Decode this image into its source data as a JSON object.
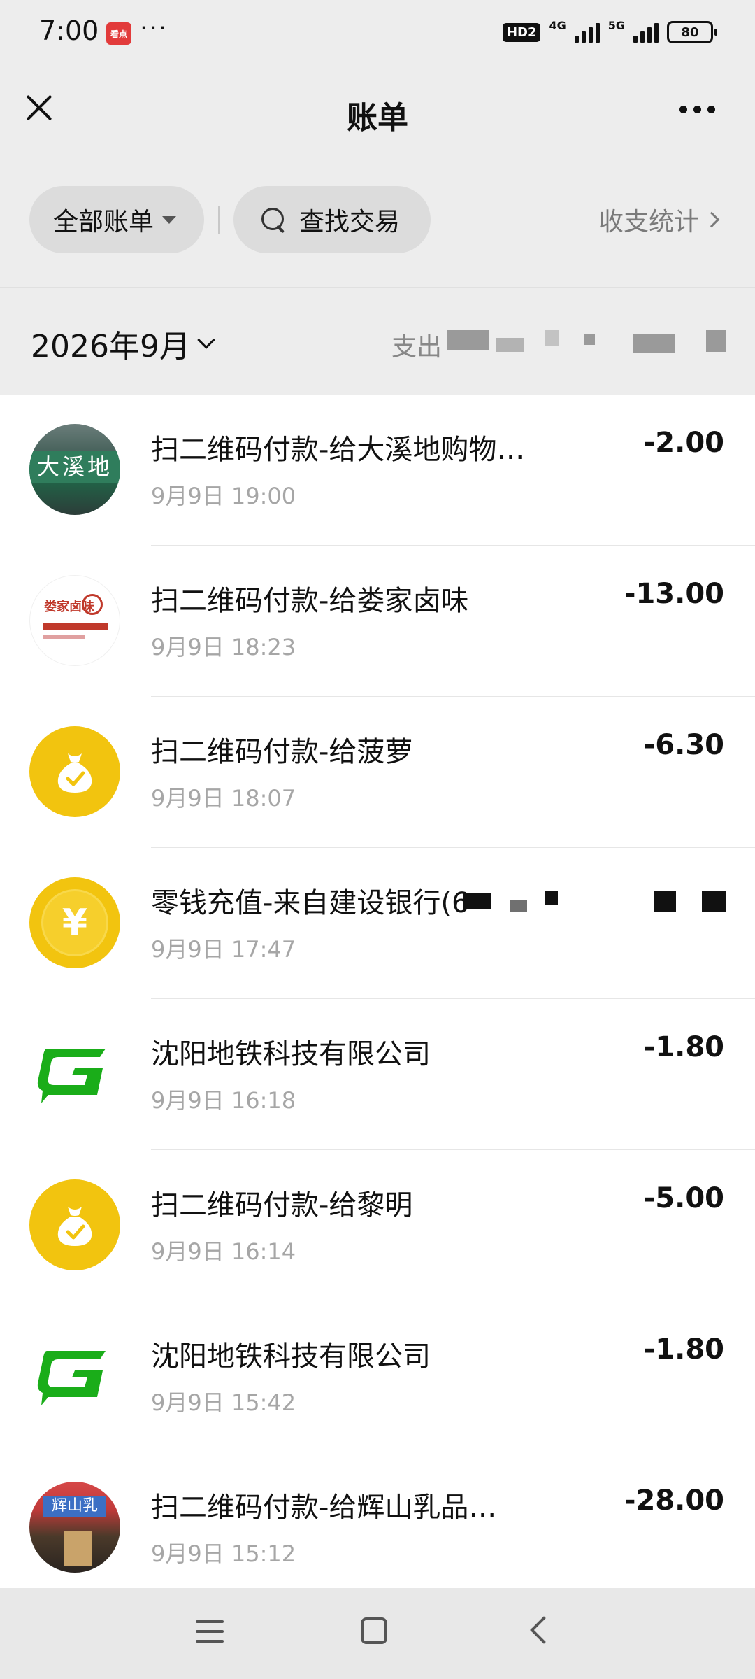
{
  "status_bar": {
    "time": "7:00",
    "app_badge": "看点",
    "more": "···",
    "hd": "HD2",
    "net1": "4G",
    "net2": "5G",
    "battery": "80"
  },
  "header": {
    "title": "账单"
  },
  "filters": {
    "all_bills": "全部账单",
    "search": "查找交易",
    "stats": "收支统计"
  },
  "month": {
    "label": "2026年9月",
    "summary_prefix": "支出"
  },
  "transactions": [
    {
      "title": "扫二维码付款-给大溪地购物…",
      "time": "9月9日 19:00",
      "amount": "-2.00",
      "avatar": "store-photo",
      "avatar_text": "大溪地"
    },
    {
      "title": "扫二维码付款-给娄家卤味",
      "time": "9月9日 18:23",
      "amount": "-13.00",
      "avatar": "store-logo",
      "avatar_text": "娄家卤味"
    },
    {
      "title": "扫二维码付款-给菠萝",
      "time": "9月9日 18:07",
      "amount": "-6.30",
      "avatar": "moneybag-icon"
    },
    {
      "title": "零钱充值-来自建设银行(6",
      "time": "9月9日 17:47",
      "amount": "",
      "avatar": "yuan-coin-icon",
      "avatar_text": "¥"
    },
    {
      "title": "沈阳地铁科技有限公司",
      "time": "9月9日 16:18",
      "amount": "-1.80",
      "avatar": "metro-logo-icon"
    },
    {
      "title": "扫二维码付款-给黎明",
      "time": "9月9日 16:14",
      "amount": "-5.00",
      "avatar": "moneybag-icon"
    },
    {
      "title": "沈阳地铁科技有限公司",
      "time": "9月9日 15:42",
      "amount": "-1.80",
      "avatar": "metro-logo-icon"
    },
    {
      "title": "扫二维码付款-给辉山乳品…",
      "time": "9月9日 15:12",
      "amount": "-28.00",
      "avatar": "store-photo",
      "avatar_text": "辉山乳"
    }
  ],
  "colors": {
    "background": "#ededed",
    "list_bg": "#ffffff",
    "accent_yellow": "#f2c40f",
    "metro_green": "#1aad19",
    "secondary_text": "#a6a6a6"
  }
}
